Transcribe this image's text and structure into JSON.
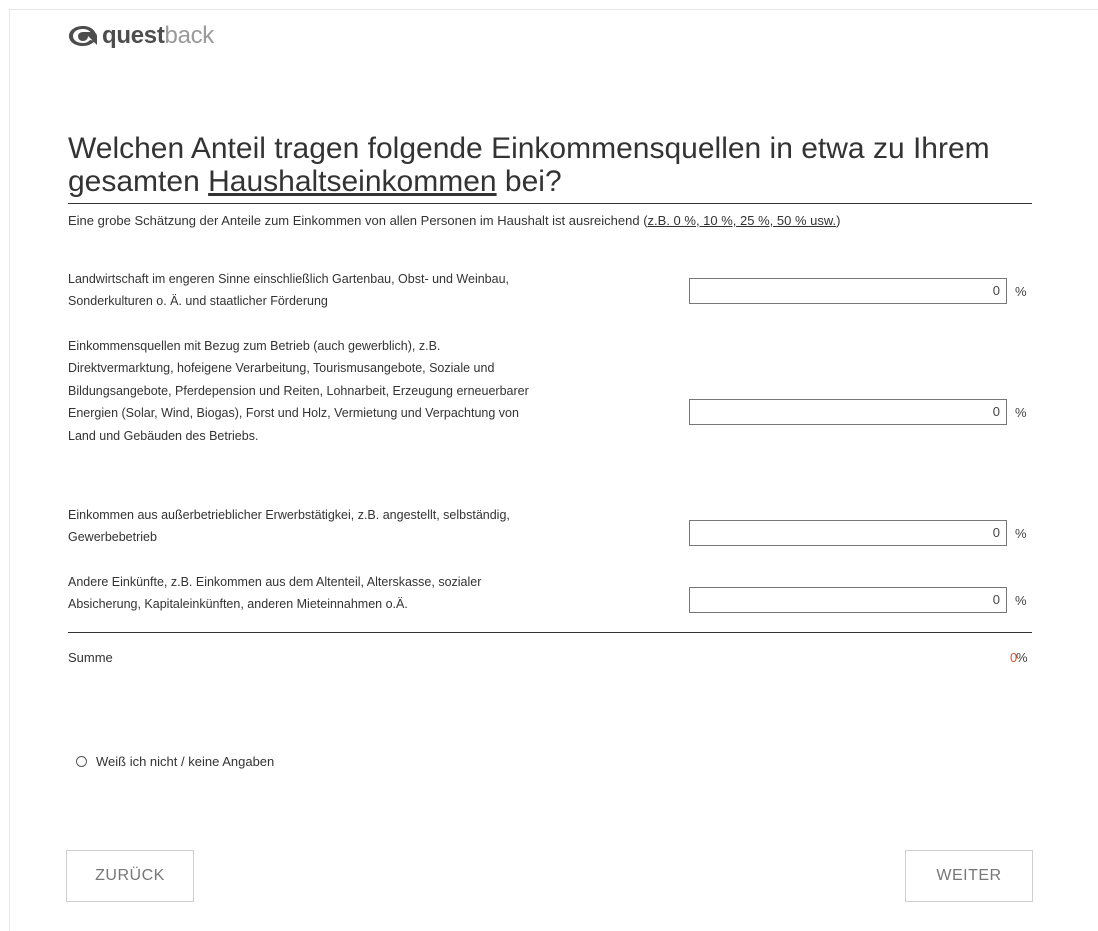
{
  "brand": {
    "name_part1": "quest",
    "name_part2": "back"
  },
  "question": {
    "text_before": "Welchen Anteil tragen folgende Einkommensquellen in etwa zu Ihrem gesamten ",
    "text_underlined": "Haushaltseinkommen",
    "text_after": " bei?"
  },
  "hint": {
    "text": "Eine grobe Schätzung der Anteile zum Einkommen von allen Personen im Haushalt ist ausreichend (",
    "example": "z.B. 0 %, 10 %, 25 %, 50 % usw.",
    "close": ")"
  },
  "rows": [
    {
      "bold": "Landwirtschaft im engeren Sinne",
      "rest": " einschließlich Gartenbau, Obst- und Weinbau, Sonderkulturen o. Ä. und staatlicher Förderung",
      "value": "0",
      "unit": "%"
    },
    {
      "bold": "Einkommensquellen mit Bezug zum Betrieb",
      "rest": " (auch gewerblich), z.B. Direktvermarktung, hofeigene Verarbeitung, Tourismusangebote, Soziale und Bildungsangebote, Pferdepension und Reiten, Lohnarbeit, Erzeugung erneuerbarer Energien (Solar, Wind, Biogas), Forst und Holz, Vermietung und Verpachtung von Land und Gebäuden des Betriebs.",
      "value": "0",
      "unit": "%"
    },
    {
      "bold": "Einkommen aus außerbetrieblicher Erwerbstätigkei",
      "rest": ", z.B. angestellt, selbständig, Gewerbebetrieb",
      "value": "0",
      "unit": "%"
    },
    {
      "bold": "Andere Einkünfte",
      "rest": ", z.B. Einkommen aus dem Altenteil, Alterskasse, sozialer Absicherung, Kapitaleinkünften, anderen Mieteinnahmen o.Ä.",
      "value": "0",
      "unit": "%"
    }
  ],
  "sum": {
    "label": "Summe",
    "value": "0",
    "unit": "%",
    "value_color": "#e0522a"
  },
  "dont_know": {
    "label": "Weiß ich nicht / keine Angaben",
    "selected": false
  },
  "nav": {
    "back_label": "ZURÜCK",
    "next_label": "WEITER"
  }
}
